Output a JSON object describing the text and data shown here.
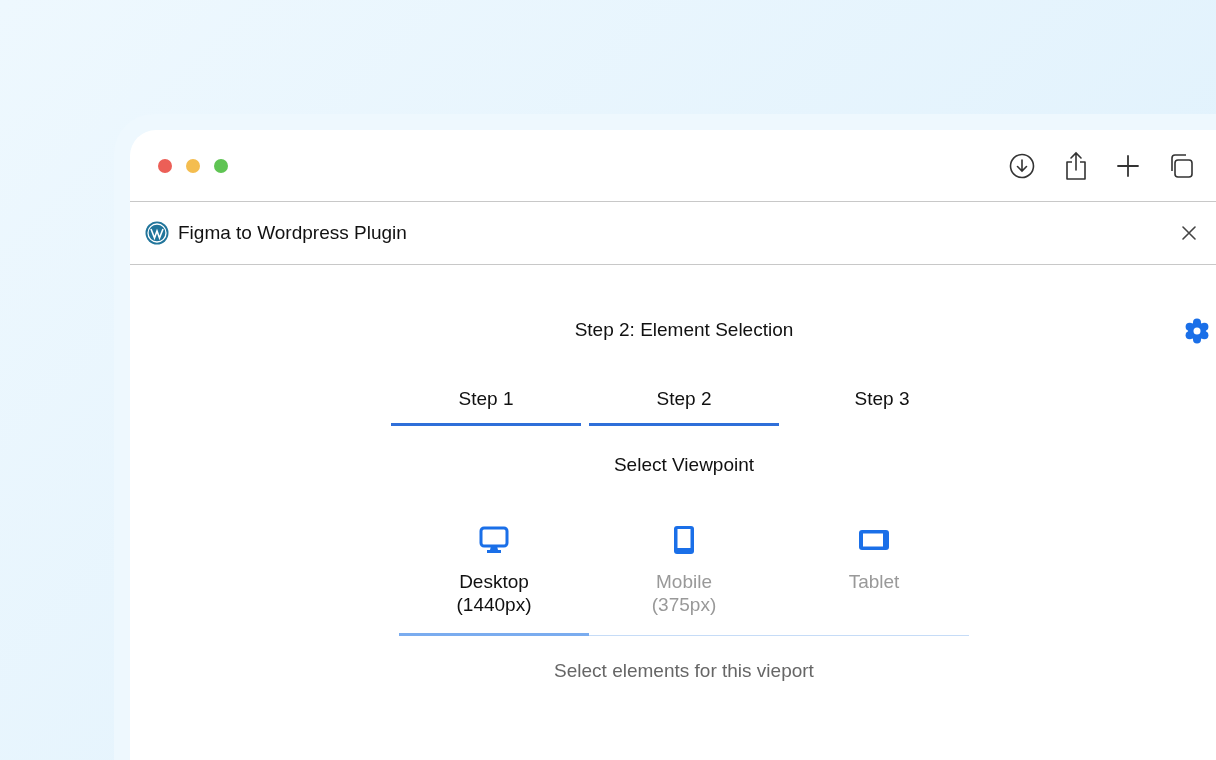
{
  "window": {
    "tab_title": "Figma to Wordpress Plugin"
  },
  "heading": "Step 2: Element Selection",
  "steps": [
    {
      "label": "Step 1",
      "completed": true
    },
    {
      "label": "Step 2",
      "completed": true
    },
    {
      "label": "Step 3",
      "completed": false
    }
  ],
  "viewpoint_title": "Select Viewpoint",
  "viewpoints": [
    {
      "kind": "desktop",
      "label": "Desktop",
      "detail": "(1440px)",
      "selected": true
    },
    {
      "kind": "mobile",
      "label": "Mobile",
      "detail": "(375px)",
      "selected": false
    },
    {
      "kind": "tablet",
      "label": "Tablet",
      "selected": false
    }
  ],
  "hint": "Select elements for this vieport"
}
